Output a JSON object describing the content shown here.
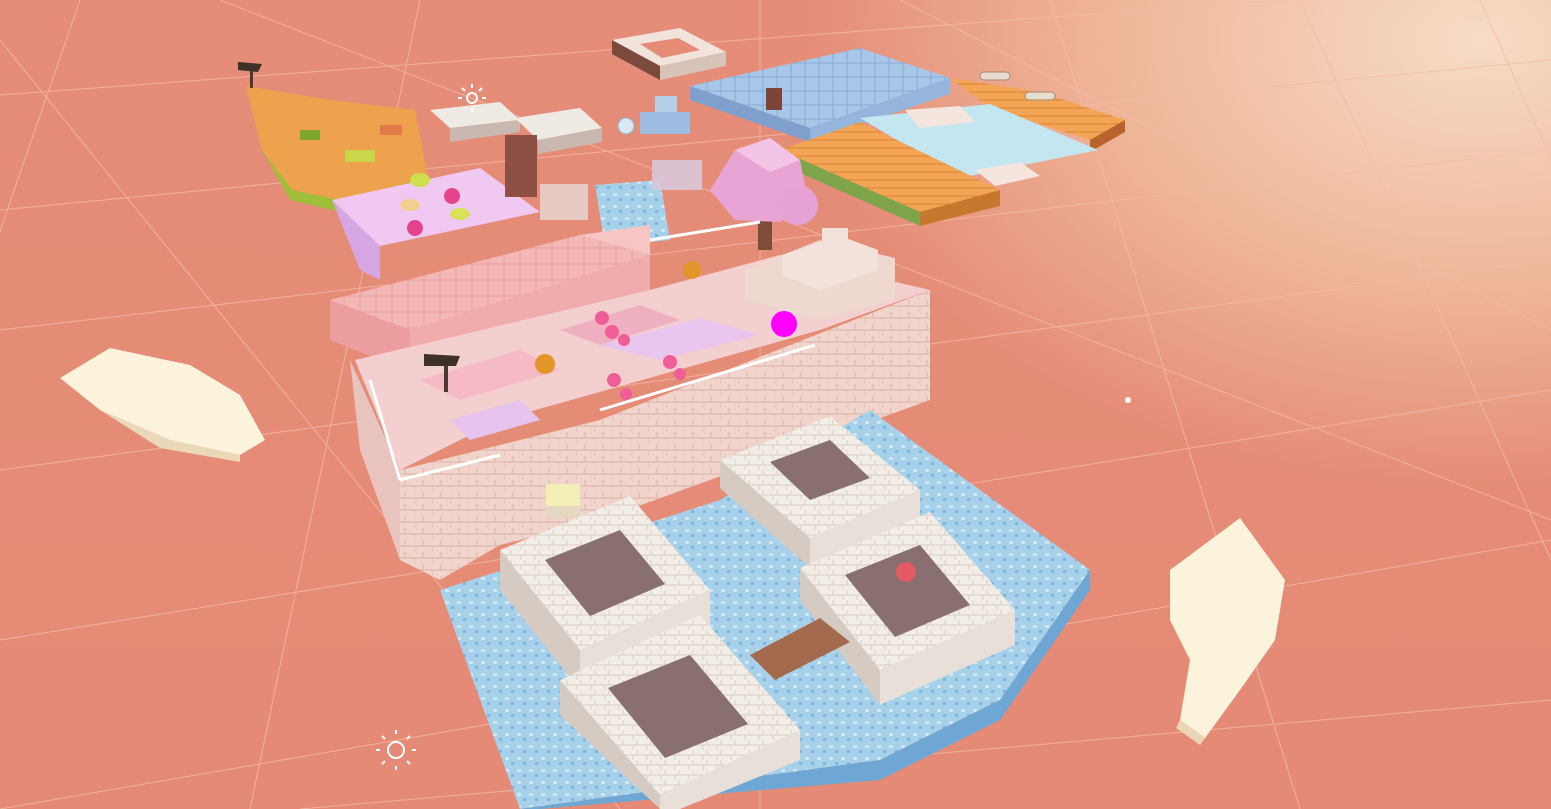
{
  "scene": {
    "type": "unity-scene-view",
    "background_color": "#e58b76",
    "grid_color": "#f4c2ae",
    "icons": [
      "sun-light-gizmo-icon",
      "signpost-icon",
      "cursor-dot-icon"
    ]
  },
  "palette": {
    "pink": "#f2b3b3",
    "pink_dark": "#e49a9c",
    "cream": "#f3ddd3",
    "white_tile": "#f1ece6",
    "water": "#9fcbe7",
    "water_dark": "#6fa7d3",
    "orange": "#f09a4a",
    "lavender": "#e6bdf0",
    "magenta_marker": "#ff00ff",
    "cloud": "#fbf3dc",
    "brown": "#7a4a3b"
  }
}
